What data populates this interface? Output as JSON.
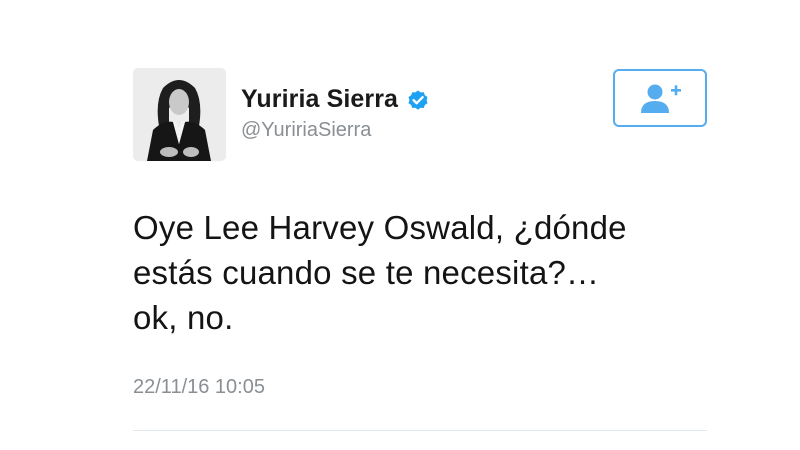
{
  "author": {
    "display_name": "Yuriria Sierra",
    "handle": "@YuririaSierra",
    "verified": true,
    "avatar_icon": "profile-photo"
  },
  "follow_button": {
    "icon": "add-user-icon",
    "accent_color": "#55acee"
  },
  "tweet": {
    "lines": [
      "Oye Lee Harvey Oswald, ¿dónde",
      "estás cuando se te necesita?…",
      "ok, no."
    ],
    "timestamp": "22/11/16 10:05"
  },
  "colors": {
    "verified_badge": "#1da1f2",
    "secondary_text": "#8a8f94",
    "primary_text": "#141414"
  }
}
